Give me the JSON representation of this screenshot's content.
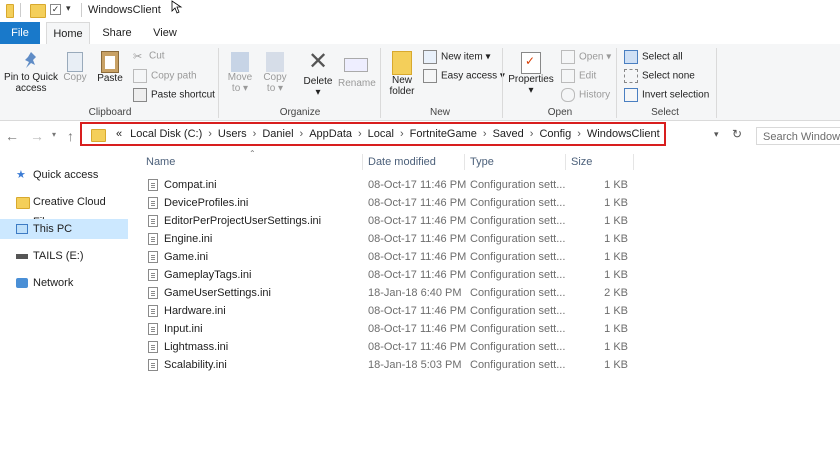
{
  "window": {
    "title": "WindowsClient"
  },
  "tabs": [
    "File",
    "Home",
    "Share",
    "View"
  ],
  "ribbon": {
    "clipboard": {
      "pin_label_1": "Pin to Quick",
      "pin_label_2": "access",
      "copy": "Copy",
      "paste": "Paste",
      "cut": "Cut",
      "copy_path": "Copy path",
      "paste_shortcut": "Paste shortcut",
      "group": "Clipboard"
    },
    "organize": {
      "move_to_1": "Move",
      "move_to_2": "to ▾",
      "copy_to_1": "Copy",
      "copy_to_2": "to ▾",
      "delete_1": "Delete",
      "delete_2": "▾",
      "rename": "Rename",
      "group": "Organize"
    },
    "new": {
      "new_folder_1": "New",
      "new_folder_2": "folder",
      "new_item": "New item ▾",
      "easy_access": "Easy access ▾",
      "group": "New"
    },
    "open": {
      "properties_1": "Properties",
      "properties_2": "▾",
      "open": "Open ▾",
      "edit": "Edit",
      "history": "History",
      "group": "Open"
    },
    "select": {
      "select_all": "Select all",
      "select_none": "Select none",
      "invert": "Invert selection",
      "group": "Select"
    }
  },
  "address": {
    "overflow": "«",
    "crumbs": [
      "Local Disk (C:)",
      "Users",
      "Daniel",
      "AppData",
      "Local",
      "FortniteGame",
      "Saved",
      "Config",
      "WindowsClient"
    ],
    "separator": "›"
  },
  "search": {
    "placeholder": "Search WindowsClient"
  },
  "nav": {
    "items": [
      {
        "label": "Quick access",
        "icon": "star-icon"
      },
      {
        "label": "Creative Cloud Files",
        "icon": "cloud-folder-icon"
      },
      {
        "label": "This PC",
        "icon": "computer-icon",
        "selected": true
      },
      {
        "label": "TAILS (E:)",
        "icon": "drive-icon"
      },
      {
        "label": "Network",
        "icon": "network-icon"
      }
    ]
  },
  "columns": {
    "name": "Name",
    "date": "Date modified",
    "type": "Type",
    "size": "Size"
  },
  "files": [
    {
      "name": "Compat.ini",
      "date": "08-Oct-17 11:46 PM",
      "type": "Configuration sett...",
      "size": "1 KB"
    },
    {
      "name": "DeviceProfiles.ini",
      "date": "08-Oct-17 11:46 PM",
      "type": "Configuration sett...",
      "size": "1 KB"
    },
    {
      "name": "EditorPerProjectUserSettings.ini",
      "date": "08-Oct-17 11:46 PM",
      "type": "Configuration sett...",
      "size": "1 KB"
    },
    {
      "name": "Engine.ini",
      "date": "08-Oct-17 11:46 PM",
      "type": "Configuration sett...",
      "size": "1 KB"
    },
    {
      "name": "Game.ini",
      "date": "08-Oct-17 11:46 PM",
      "type": "Configuration sett...",
      "size": "1 KB"
    },
    {
      "name": "GameplayTags.ini",
      "date": "08-Oct-17 11:46 PM",
      "type": "Configuration sett...",
      "size": "1 KB"
    },
    {
      "name": "GameUserSettings.ini",
      "date": "18-Jan-18 6:40 PM",
      "type": "Configuration sett...",
      "size": "2 KB"
    },
    {
      "name": "Hardware.ini",
      "date": "08-Oct-17 11:46 PM",
      "type": "Configuration sett...",
      "size": "1 KB"
    },
    {
      "name": "Input.ini",
      "date": "08-Oct-17 11:46 PM",
      "type": "Configuration sett...",
      "size": "1 KB"
    },
    {
      "name": "Lightmass.ini",
      "date": "08-Oct-17 11:46 PM",
      "type": "Configuration sett...",
      "size": "1 KB"
    },
    {
      "name": "Scalability.ini",
      "date": "18-Jan-18 5:03 PM",
      "type": "Configuration sett...",
      "size": "1 KB"
    }
  ],
  "colors": {
    "accent": "#1979ca",
    "highlight": "#d81e1e",
    "selected": "#cce8ff"
  }
}
